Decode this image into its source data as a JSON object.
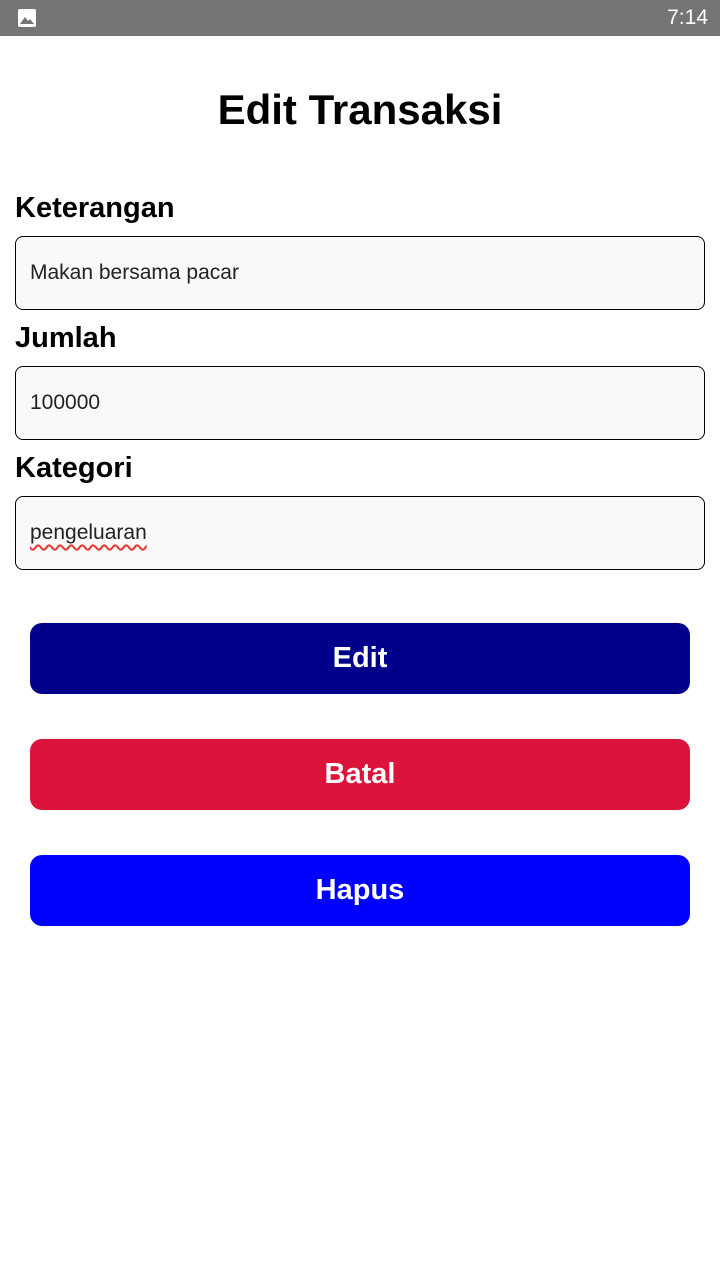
{
  "status_bar": {
    "time": "7:14",
    "notification_icon": "image-icon"
  },
  "page": {
    "title": "Edit Transaksi"
  },
  "form": {
    "keterangan": {
      "label": "Keterangan",
      "value": "Makan bersama pacar"
    },
    "jumlah": {
      "label": "Jumlah",
      "value": "100000"
    },
    "kategori": {
      "label": "Kategori",
      "value": "pengeluaran"
    }
  },
  "buttons": {
    "edit": {
      "label": "Edit",
      "color": "#00008B"
    },
    "batal": {
      "label": "Batal",
      "color": "#DC143C"
    },
    "hapus": {
      "label": "Hapus",
      "color": "#0000FF"
    }
  }
}
